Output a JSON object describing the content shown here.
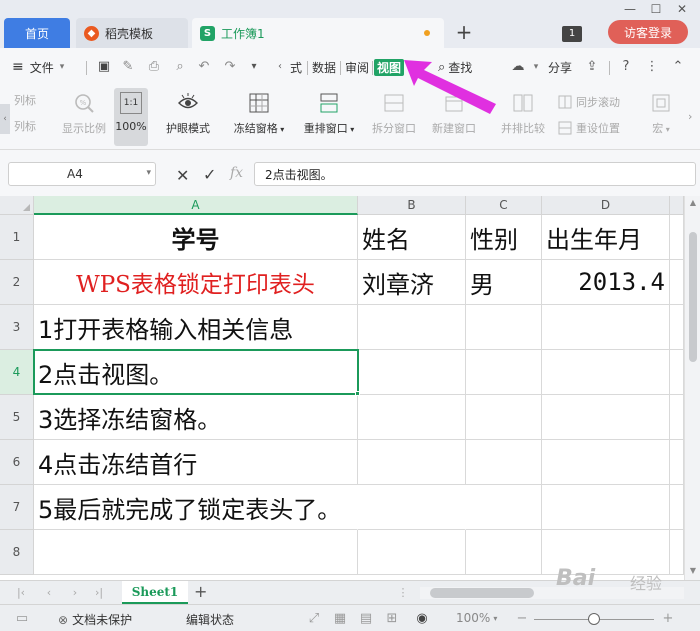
{
  "titlebar": {
    "tabs": [
      {
        "label": "首页"
      },
      {
        "label": "稻壳模板"
      },
      {
        "label": "工作簿1"
      }
    ],
    "window_count": "1",
    "guest_login": "访客登录"
  },
  "menubar": {
    "file": "文件",
    "tabs": [
      "式",
      "数据",
      "审阅",
      "视图"
    ],
    "search": "查找",
    "share": "分享"
  },
  "ribbon": {
    "left_items": [
      "列标",
      "列标"
    ],
    "show_ratio": "显示比例",
    "zoom_100": "100%",
    "zoom_icon_text": "1:1",
    "eye_mode": "护眼模式",
    "freeze_panes": "冻结窗格",
    "rearrange": "重排窗口",
    "split": "拆分窗口",
    "new_window": "新建窗口",
    "side_by_side": "并排比较",
    "sync_scroll": "同步滚动",
    "reset_position": "重设位置",
    "macro": "宏"
  },
  "formula_bar": {
    "name_box": "A4",
    "fx": "fx",
    "content": "2点击视图。"
  },
  "grid": {
    "columns": [
      "A",
      "B",
      "C",
      "D"
    ],
    "rows": [
      "1",
      "2",
      "3",
      "4",
      "5",
      "6",
      "7",
      "8"
    ],
    "cells": {
      "A1": "学号",
      "B1": "姓名",
      "C1": "性别",
      "D1": "出生年月",
      "A2": "WPS表格锁定打印表头",
      "B2": "刘章济",
      "C2": "男",
      "D2": "2013.4",
      "A3": "1打开表格输入相关信息",
      "A4": "2点击视图。",
      "A5": "3选择冻结窗格。",
      "A6": "4点击冻结首行",
      "A7": "5最后就完成了锁定表头了。"
    }
  },
  "sheetbar": {
    "sheet_name": "Sheet1"
  },
  "statusbar": {
    "protection": "文档未保护",
    "mode": "编辑状态",
    "zoom": "100%",
    "zoom_level": 0.5
  },
  "watermark": {
    "text": "Bai",
    "sub": "经验"
  },
  "colors": {
    "accent_green": "#1b9a5a",
    "annotation_arrow": "#e030e0",
    "title_red": "#e02020",
    "home_tab": "#3f7de3",
    "guest_button": "#e06058"
  }
}
